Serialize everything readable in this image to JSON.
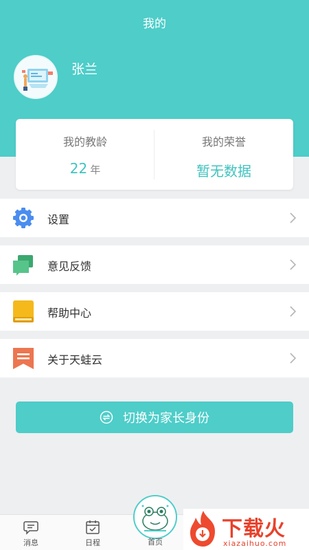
{
  "header": {
    "title": "我的"
  },
  "user": {
    "name": "张兰"
  },
  "stats": {
    "teaching_years": {
      "label": "我的教龄",
      "value": "22",
      "unit": "年"
    },
    "honors": {
      "label": "我的荣誉",
      "value": "暂无数据"
    }
  },
  "menu": [
    {
      "label": "设置",
      "icon": "gear-icon"
    },
    {
      "label": "意见反馈",
      "icon": "feedback-icon"
    },
    {
      "label": "帮助中心",
      "icon": "book-icon"
    },
    {
      "label": "关于天蛙云",
      "icon": "bookmark-icon"
    }
  ],
  "switch_button": {
    "label": "切换为家长身份"
  },
  "tabbar": {
    "messages": "消息",
    "schedule": "日程",
    "home": "首页"
  },
  "watermark": {
    "title": "下载火",
    "subtitle": "xiazaihuo.com"
  },
  "colors": {
    "accent": "#4ecdc9",
    "accent_text": "#3fc3bf",
    "watermark": "#e8412b"
  }
}
